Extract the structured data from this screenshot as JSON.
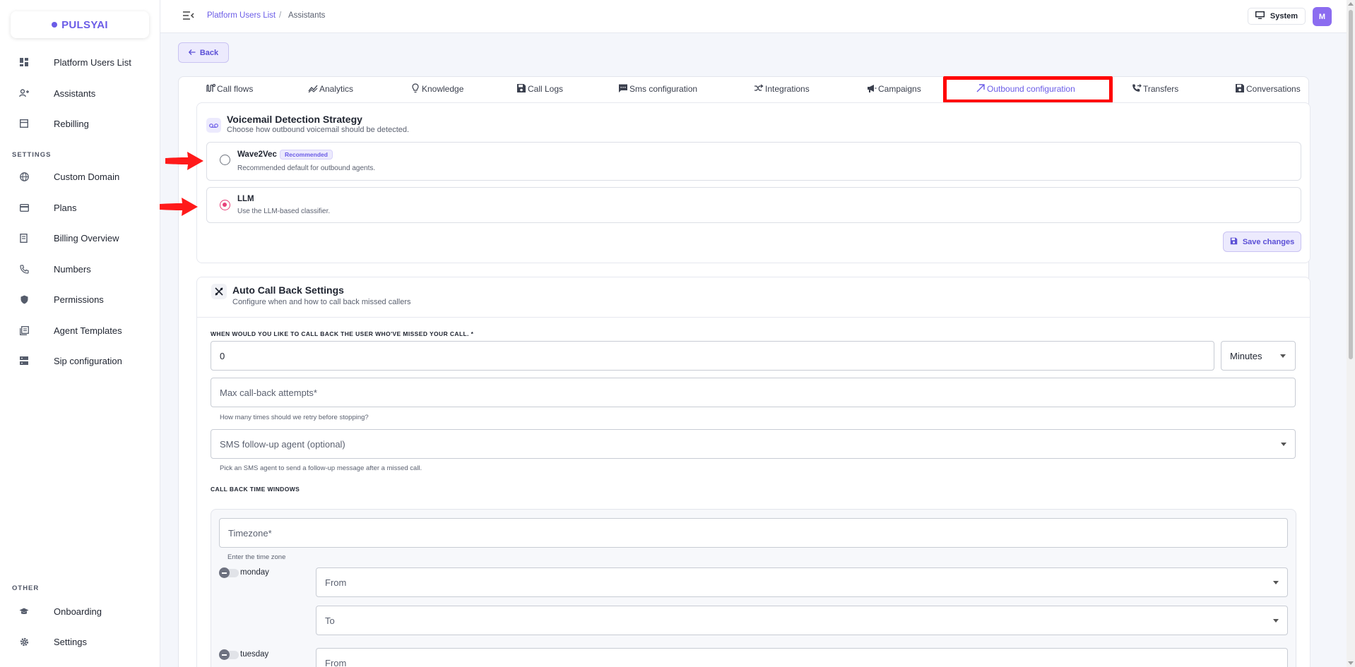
{
  "app": {
    "logo": "PULSYAI",
    "brand_color": "#6b5ce7"
  },
  "sidebar": {
    "items": [
      {
        "label": "Platform Users List",
        "icon": "dashboard-icon"
      },
      {
        "label": "Assistants",
        "icon": "add-user-icon"
      },
      {
        "label": "Rebilling",
        "icon": "store-icon"
      }
    ],
    "settings_label": "SETTINGS",
    "settings_items": [
      {
        "label": "Custom Domain",
        "icon": "globe-icon"
      },
      {
        "label": "Plans",
        "icon": "credit-card-icon"
      },
      {
        "label": "Billing Overview",
        "icon": "receipt-icon"
      },
      {
        "label": "Numbers",
        "icon": "phone-icon"
      },
      {
        "label": "Permissions",
        "icon": "shield-icon"
      },
      {
        "label": "Agent Templates",
        "icon": "template-icon"
      },
      {
        "label": "Sip configuration",
        "icon": "server-icon"
      }
    ],
    "other_label": "OTHER",
    "other_items": [
      {
        "label": "Onboarding",
        "icon": "graduation-cap-icon"
      },
      {
        "label": "Settings",
        "icon": "gear-icon"
      }
    ]
  },
  "topbar": {
    "breadcrumb": [
      "Platform Users List",
      "Assistants"
    ],
    "separator": "/",
    "system_label": "System",
    "avatar_initial": "M"
  },
  "back_label": "Back",
  "tabs": [
    {
      "label": "Call flows",
      "icon": "flow-icon"
    },
    {
      "label": "Analytics",
      "icon": "analytics-icon"
    },
    {
      "label": "Knowledge",
      "icon": "lightbulb-icon"
    },
    {
      "label": "Call Logs",
      "icon": "save-icon"
    },
    {
      "label": "Sms configuration",
      "icon": "sms-icon"
    },
    {
      "label": "Integrations",
      "icon": "merge-icon"
    },
    {
      "label": "Campaigns",
      "icon": "megaphone-icon"
    },
    {
      "label": "Outbound configuration",
      "icon": "arrow-up-right-icon",
      "active": true
    },
    {
      "label": "Transfers",
      "icon": "phone-forward-icon"
    },
    {
      "label": "Conversations",
      "icon": "save-icon"
    }
  ],
  "voicemail": {
    "title": "Voicemail Detection Strategy",
    "subtitle": "Choose how outbound voicemail should be detected.",
    "options": [
      {
        "title": "Wave2Vec",
        "badge": "Recommended",
        "desc": "Recommended default for outbound agents.",
        "selected": false
      },
      {
        "title": "LLM",
        "desc": "Use the LLM-based classifier.",
        "selected": true
      }
    ],
    "save_label": "Save changes"
  },
  "auto_callback": {
    "title": "Auto Call Back Settings",
    "subtitle": "Configure when and how to call back missed callers",
    "delay_label": "WHEN WOULD YOU LIKE TO CALL BACK THE USER WHO'VE MISSED YOUR CALL. *",
    "delay_value": "0",
    "delay_unit": "Minutes",
    "max_attempts_placeholder": "Max call-back attempts*",
    "max_attempts_help": "How many times should we retry before stopping?",
    "sms_agent_placeholder": "SMS follow-up agent (optional)",
    "sms_agent_help": "Pick an SMS agent to send a follow-up message after a missed call.",
    "windows_label": "CALL BACK TIME WINDOWS",
    "timezone_placeholder": "Timezone*",
    "timezone_help": "Enter the time zone",
    "days": [
      {
        "day": "monday",
        "from": "From",
        "to": "To"
      },
      {
        "day": "tuesday",
        "from": "From"
      }
    ]
  },
  "annotation_color": "#ff0000"
}
